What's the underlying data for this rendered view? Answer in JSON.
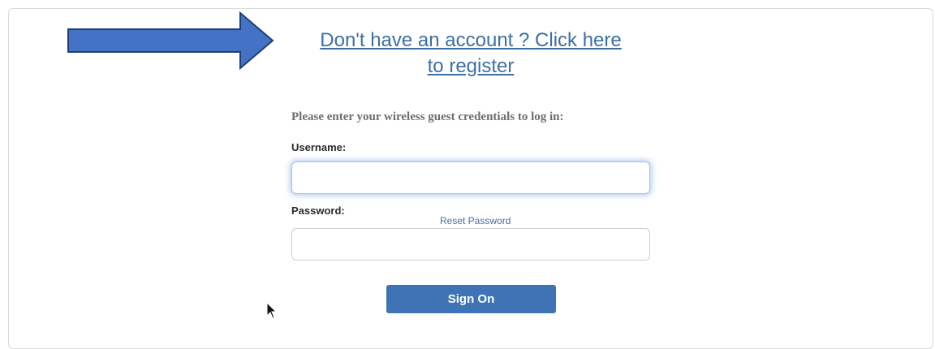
{
  "register_link": {
    "line1": "Don't have an account ? Click here",
    "line2": "to register"
  },
  "login_form": {
    "prompt": "Please enter your wireless guest credentials to log in:",
    "username_label": "Username:",
    "username_value": "",
    "password_label": "Password:",
    "password_value": "",
    "reset_password_label": "Reset Password",
    "sign_on_label": "Sign On"
  },
  "icons": {
    "arrow": "right-arrow-icon",
    "cursor": "mouse-pointer-icon"
  },
  "colors": {
    "arrow_fill": "#4472c4",
    "arrow_stroke": "#1f3f74",
    "link": "#3c6fa3",
    "button": "#3e74b5",
    "focus_glow": "#78a5e6"
  }
}
